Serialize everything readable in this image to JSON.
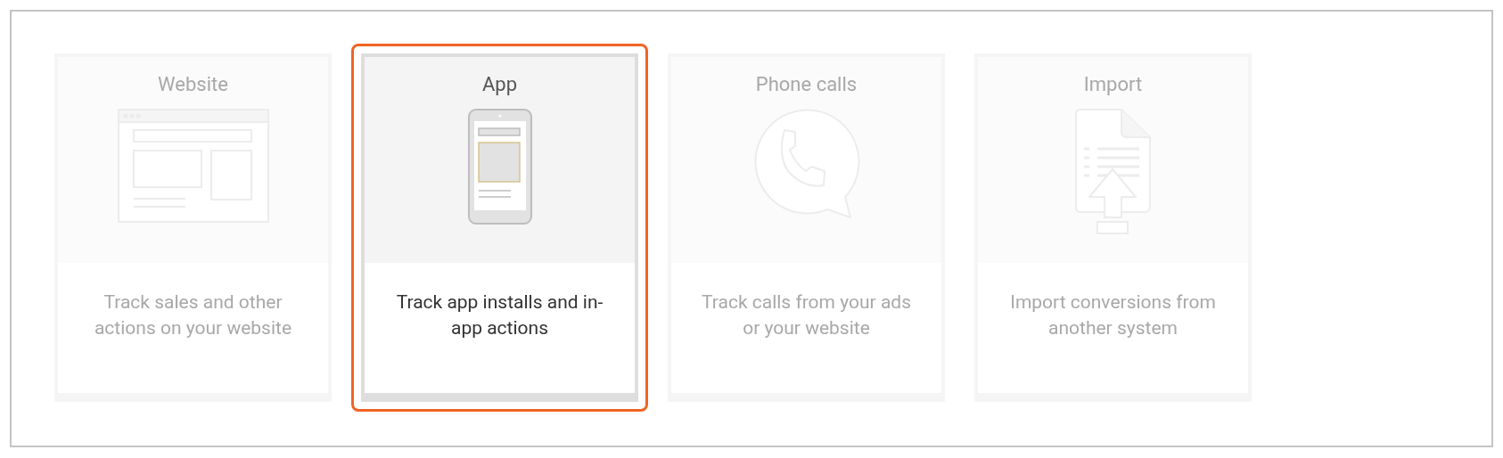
{
  "cards": [
    {
      "kind": "website",
      "title": "Website",
      "description": "Track sales and other actions on your website",
      "selected": false
    },
    {
      "kind": "app",
      "title": "App",
      "description": "Track app installs and in-app actions",
      "selected": true
    },
    {
      "kind": "phone",
      "title": "Phone calls",
      "description": "Track calls from your ads or your website",
      "selected": false
    },
    {
      "kind": "import",
      "title": "Import",
      "description": "Import conversions from another system",
      "selected": false
    }
  ]
}
